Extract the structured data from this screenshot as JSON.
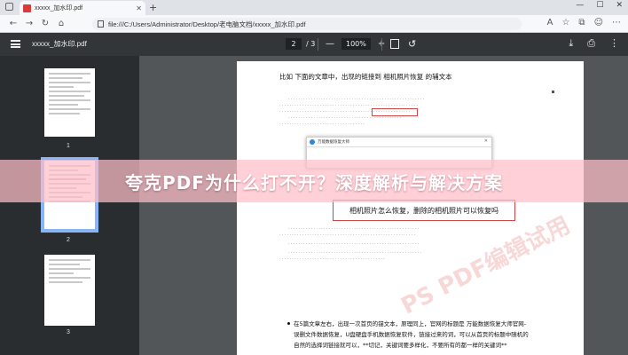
{
  "browser": {
    "tab_title": "xxxxx_加水印.pdf",
    "url": "file:///C:/Users/Administrator/Desktop/老电脑文档/xxxxx_加水印.pdf"
  },
  "pdf_toolbar": {
    "file_name": "xxxxx_加水印.pdf",
    "current_page": "2",
    "total_pages": "/ 3",
    "zoom": "100%",
    "zoom_out": "—",
    "zoom_in": "+"
  },
  "sidebar": {
    "thumbnails": [
      {
        "label": "1"
      },
      {
        "label": "2"
      },
      {
        "label": "3"
      }
    ]
  },
  "document": {
    "title": "比如  下面的文章中，出现的链接到  相机照片恢复  的辅文本",
    "dialog_title": "万能数据恢复大师",
    "highlight_box": "相机照片怎么恢复，删除的相机照片可以恢复吗",
    "bottom_text_1": "在5篇文章左右，出现一次首页的锚文本，原理同上，官网的标题是  万能数据恢复大师官网-",
    "bottom_text_2": "误删文件数据恢复，U盘硬盘手机数据恢复软件，链接过来的词，可以从首页的标题中随机的",
    "bottom_text_3": "自然的选择词链接就可以，**切记，关键词要多样化，不要所有的都一样的关键词**",
    "watermark": "PS PDF编辑试用"
  },
  "banner": {
    "text": "夸克PDF为什么打不开？深度解析与解决方案"
  }
}
